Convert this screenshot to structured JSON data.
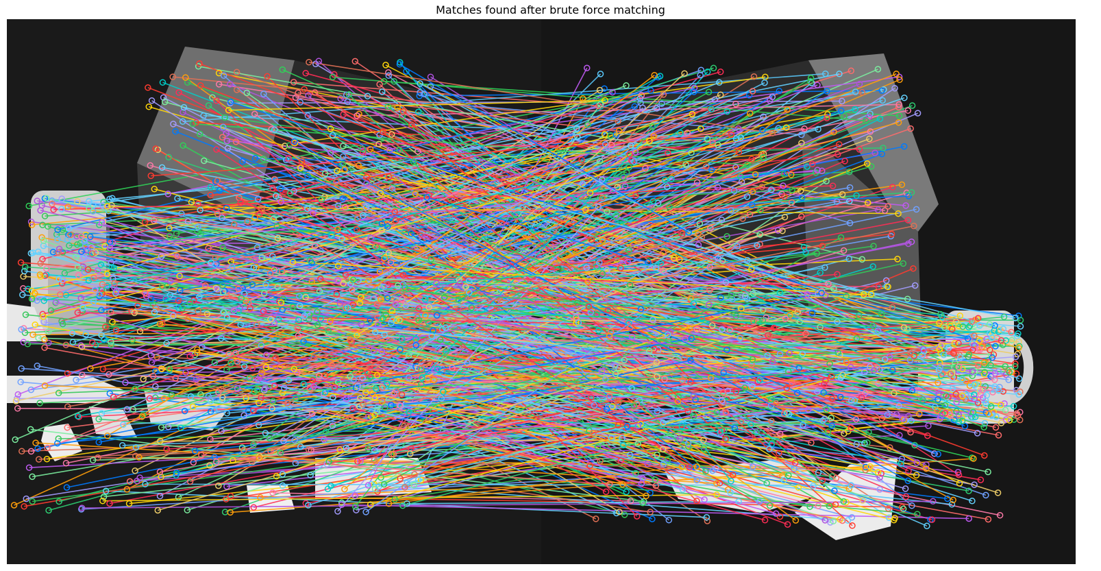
{
  "figure": {
    "title": "Matches found after brute force matching"
  },
  "image_content": {
    "description_hidden": true,
    "left_image_objects": [
      "box",
      "left-mug",
      "white-cutouts"
    ],
    "right_image_objects": [
      "box",
      "right-mug",
      "white-cutouts"
    ]
  },
  "colors": {
    "background": "#1a1a1a",
    "box_face": "#8c8c8c",
    "box_dark": "#2a2a2a",
    "mug": "#d9d9d9",
    "cutout": "#eeeeee",
    "match_palette": [
      "#ff3b30",
      "#34c759",
      "#007aff",
      "#ff9f0a",
      "#af52de",
      "#5ac8fa",
      "#ffd60a",
      "#ff2d55",
      "#30d158",
      "#bf5af2",
      "#64d2ff",
      "#ff6b6b",
      "#7bed9f",
      "#70a1ff",
      "#eccc68",
      "#a29bfe",
      "#fd79a8",
      "#00cec9",
      "#e17055",
      "#2ecc71"
    ]
  }
}
